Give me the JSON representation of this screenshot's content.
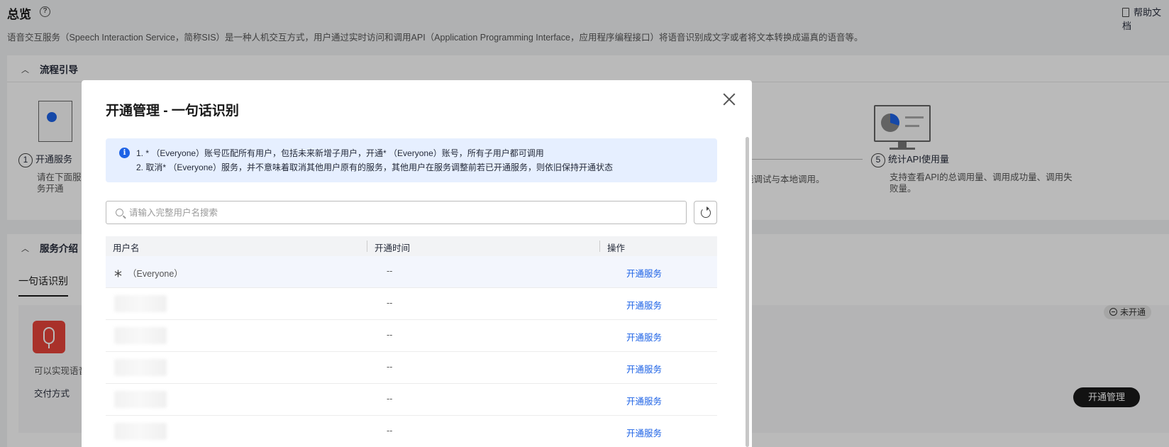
{
  "page": {
    "title": "总览",
    "help_doc": "帮助文档",
    "description": "语音交互服务（Speech Interaction Service，简称SIS）是一种人机交互方式，用户通过实时访问和调用API（Application Programming Interface，应用程序编程接口）将语音识别成文字或者将文本转换成逼真的语音等。",
    "flow_guide": {
      "title": "流程引导",
      "step1": {
        "num": "1",
        "label": "开通服务",
        "desc": "请在下面服务开通"
      },
      "step4_desc": "线调试与本地调用。",
      "step5": {
        "num": "5",
        "label": "统计API使用量",
        "desc": "支持查看API的总调用量、调用成功量、调用失败量。"
      }
    },
    "service_intro": {
      "title": "服务介绍",
      "active_tab": "一句话识别",
      "card_dash": "一",
      "desc": "可以实现语音",
      "delivery_label": "交付方式",
      "status": "未开通",
      "manage_button": "开通管理"
    }
  },
  "modal": {
    "title": "开通管理 - 一句话识别",
    "info_lines": [
      "1. * （Everyone）账号匹配所有用户，包括未来新增子用户，开通* （Everyone）账号，所有子用户都可调用",
      "2. 取消* （Everyone）服务，并不意味着取消其他用户原有的服务，其他用户在服务调整前若已开通服务，则依旧保持开通状态"
    ],
    "search": {
      "placeholder": "请输入完整用户名搜索",
      "value": ""
    },
    "table": {
      "headers": {
        "user": "用户名",
        "time": "开通时间",
        "op": "操作"
      },
      "rows": [
        {
          "user_star": "*",
          "user": "（Everyone）",
          "time": "--",
          "op": "开通服务"
        },
        {
          "time": "--",
          "op": "开通服务"
        },
        {
          "time": "--",
          "op": "开通服务"
        },
        {
          "time": "--",
          "op": "开通服务"
        },
        {
          "time": "--",
          "op": "开通服务"
        },
        {
          "time": "--",
          "op": "开通服务"
        }
      ]
    }
  },
  "colors": {
    "accent": "#1e63e6",
    "info_bg": "#e6efff",
    "primary_button": "#191919",
    "service_icon": "#e8443a"
  },
  "icons": [
    "help-icon",
    "doc-icon",
    "chevron-up-icon",
    "info-icon",
    "close-icon",
    "search-icon",
    "refresh-icon",
    "mic-icon",
    "minus-circle-icon"
  ]
}
